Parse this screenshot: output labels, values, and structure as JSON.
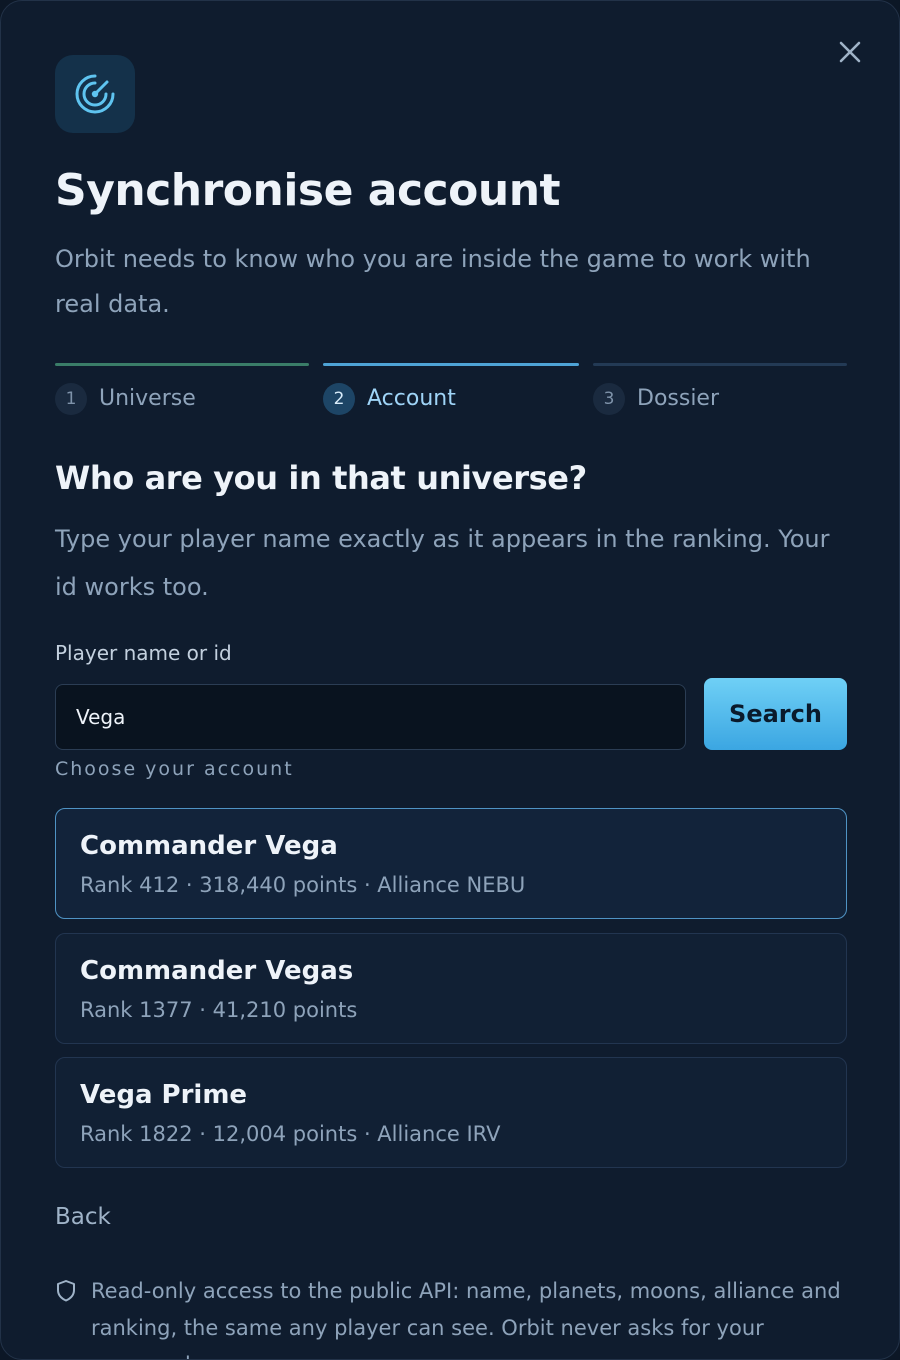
{
  "dialog": {
    "title": "Synchronise account",
    "subtitle": "Orbit needs to know who you are inside the game to work with real data.",
    "close_icon": "close-icon",
    "app_icon": "radar-icon"
  },
  "stepper": {
    "steps": [
      {
        "number": "1",
        "label": "Universe",
        "state": "complete"
      },
      {
        "number": "2",
        "label": "Account",
        "state": "active"
      },
      {
        "number": "3",
        "label": "Dossier",
        "state": "upcoming"
      }
    ]
  },
  "section": {
    "title": "Who are you in that universe?",
    "description": "Type your player name exactly as it appears in the ranking. Your id works too."
  },
  "search": {
    "label": "Player name or id",
    "value": "Vega",
    "button_label": "Search"
  },
  "results": {
    "label": "Choose your account",
    "items": [
      {
        "name": "Commander Vega",
        "meta": "Rank 412 · 318,440 points · Alliance NEBU",
        "selected": true
      },
      {
        "name": "Commander Vegas",
        "meta": "Rank 1377 · 41,210 points",
        "selected": false
      },
      {
        "name": "Vega Prime",
        "meta": "Rank 1822 · 12,004 points · Alliance IRV",
        "selected": false
      }
    ]
  },
  "footer": {
    "back_label": "Back",
    "notice_icon": "shield-icon",
    "notice": "Read-only access to the public API: name, planets, moons, alliance and ranking, the same any player can see. Orbit never asks for your password"
  },
  "colors": {
    "accent": "#4ea3d6",
    "complete": "#3a7d68",
    "background": "#0f1c2e"
  }
}
